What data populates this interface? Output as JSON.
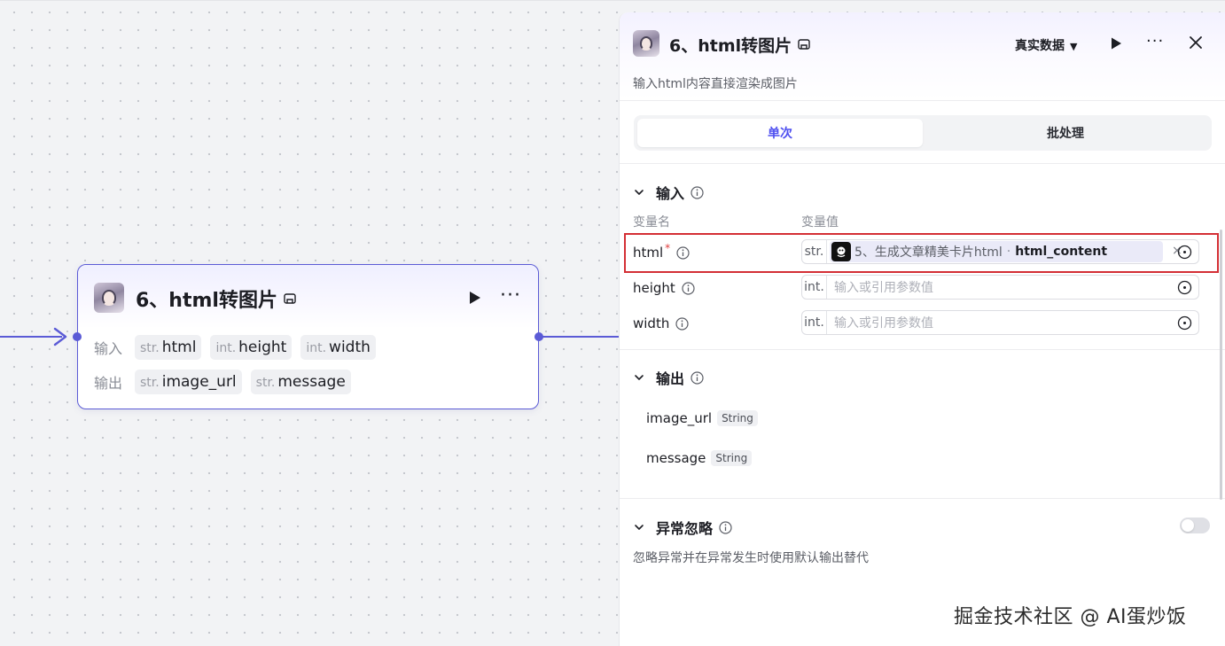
{
  "node": {
    "title": "6、html转图片",
    "input_label": "输入",
    "output_label": "输出",
    "inputs": [
      {
        "type": "str.",
        "name": "html"
      },
      {
        "type": "int.",
        "name": "height"
      },
      {
        "type": "int.",
        "name": "width"
      }
    ],
    "outputs": [
      {
        "type": "str.",
        "name": "image_url"
      },
      {
        "type": "str.",
        "name": "message"
      }
    ]
  },
  "panel": {
    "title": "6、html转图片",
    "data_mode": "真实数据",
    "description": "输入html内容直接渲染成图片",
    "tabs": [
      "单次",
      "批处理"
    ],
    "active_tab": "单次",
    "input_section": {
      "title": "输入",
      "col_name": "变量名",
      "col_value": "变量值",
      "variables": [
        {
          "name": "html",
          "required": "*",
          "type": "str.",
          "ref_node": "5、生成文章精美卡片html",
          "ref_sep": "·",
          "ref_var": "html_content",
          "clear": "×"
        },
        {
          "name": "height",
          "type": "int.",
          "placeholder": "输入或引用参数值"
        },
        {
          "name": "width",
          "type": "int.",
          "placeholder": "输入或引用参数值"
        }
      ]
    },
    "output_section": {
      "title": "输出",
      "items": [
        {
          "name": "image_url",
          "type": "String"
        },
        {
          "name": "message",
          "type": "String"
        }
      ]
    },
    "skip_section": {
      "title": "异常忽略",
      "description": "忽略异常并在异常发生时使用默认输出替代",
      "enabled": false
    }
  },
  "watermark": "掘金技术社区 @ AI蛋炒饭",
  "colors": {
    "accent": "#5b5bd6",
    "highlight_border": "#d42f35",
    "active_tab_text": "#4e4ff0"
  },
  "icons": [
    "play-icon",
    "more-icon",
    "close-icon",
    "chevron-down-icon",
    "info-icon",
    "variable-picker-icon",
    "arrow-icon"
  ]
}
